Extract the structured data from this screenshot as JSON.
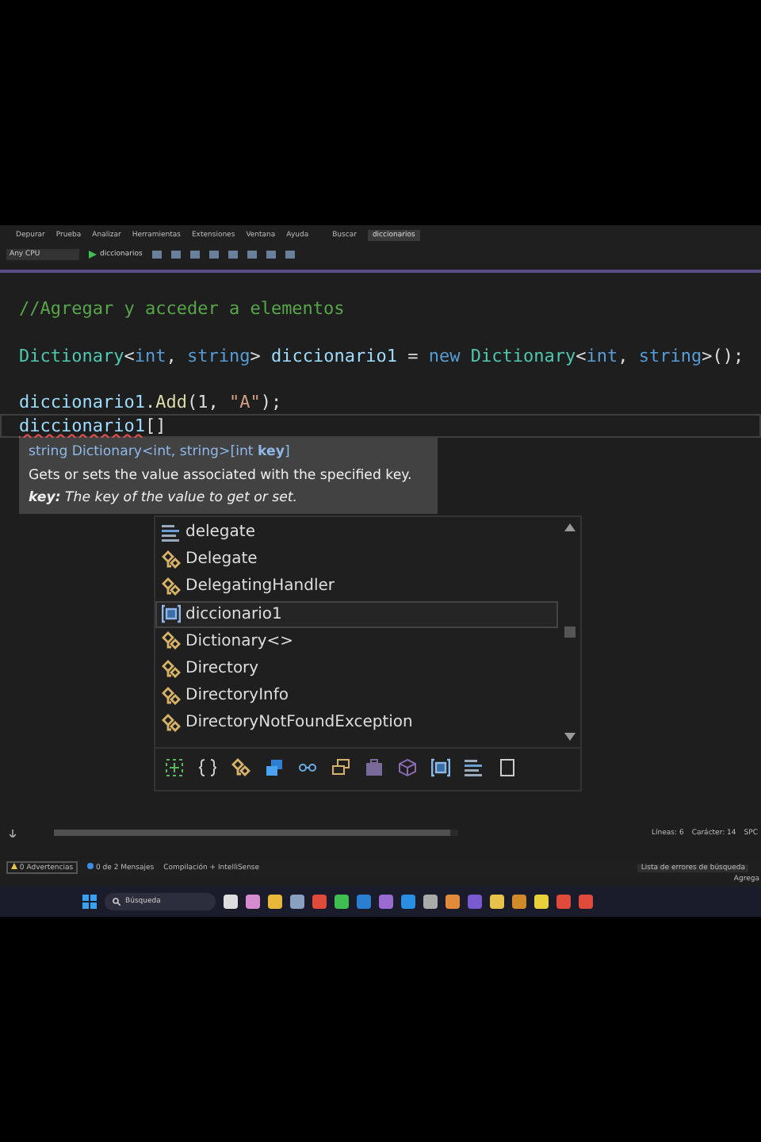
{
  "menu_bar": {
    "items": [
      "Depurar",
      "Prueba",
      "Analizar",
      "Herramientas",
      "Extensiones",
      "Ventana",
      "Ayuda"
    ],
    "search": "Buscar",
    "solution": "diccionarios"
  },
  "toolbar": {
    "platform": "Any CPU",
    "start": "diccionarios"
  },
  "editor": {
    "lines": [
      {
        "current": false,
        "tokens": [
          {
            "text": "//Agregar y acceder a elementos",
            "kind": "comment"
          }
        ]
      },
      {
        "current": false
      },
      {
        "current": false,
        "tokens": [
          {
            "text": "Dictionary",
            "kind": "type"
          },
          {
            "text": "<",
            "kind": "plain"
          },
          {
            "text": "int",
            "kind": "keyword"
          },
          {
            "text": ", ",
            "kind": "plain"
          },
          {
            "text": "string",
            "kind": "keyword"
          },
          {
            "text": "> ",
            "kind": "plain"
          },
          {
            "text": "diccionario1",
            "kind": "variable"
          },
          {
            "text": " = ",
            "kind": "plain"
          },
          {
            "text": "new ",
            "kind": "keyword"
          },
          {
            "text": "Dictionary",
            "kind": "type"
          },
          {
            "text": "<",
            "kind": "plain"
          },
          {
            "text": "int",
            "kind": "keyword"
          },
          {
            "text": ", ",
            "kind": "plain"
          },
          {
            "text": "string",
            "kind": "keyword"
          },
          {
            "text": ">();",
            "kind": "plain"
          }
        ]
      },
      {
        "current": false
      },
      {
        "current": false,
        "tokens": [
          {
            "text": "diccionario1",
            "kind": "variable"
          },
          {
            "text": ".",
            "kind": "plain"
          },
          {
            "text": "Add",
            "kind": "method"
          },
          {
            "text": "(1, ",
            "kind": "plain"
          },
          {
            "text": "\"A\"",
            "kind": "string"
          },
          {
            "text": ");",
            "kind": "plain"
          }
        ]
      },
      {
        "current": true,
        "tokens": [
          {
            "text": "diccionario1",
            "kind": "variable",
            "error": true
          },
          {
            "text": "[]",
            "kind": "plain"
          }
        ]
      }
    ]
  },
  "tooltip": {
    "signature": "string Dictionary<int, string>[int **key**]",
    "description": "Gets or sets the value associated with the specified key.",
    "parameter": "**key:** The key of the value to get or set."
  },
  "completion": {
    "items": [
      {
        "label": "delegate",
        "kind": "keyword",
        "selected": false
      },
      {
        "label": "Delegate",
        "kind": "class",
        "selected": false
      },
      {
        "label": "DelegatingHandler",
        "kind": "class",
        "selected": false
      },
      {
        "label": "diccionario1",
        "kind": "local",
        "selected": true
      },
      {
        "label": "Dictionary<>",
        "kind": "class",
        "selected": false
      },
      {
        "label": "Directory",
        "kind": "class",
        "selected": false
      },
      {
        "label": "DirectoryInfo",
        "kind": "class",
        "selected": false
      },
      {
        "label": "DirectoryNotFoundException",
        "kind": "class",
        "selected": false
      }
    ]
  },
  "status": {
    "lines": "Líneas: 6",
    "column": "Carácter: 14",
    "spacing": "SPC",
    "warnings": "0 Advertencias",
    "messages": "0 de 2 Mensajes",
    "build_filter": "Compilación + IntelliSense",
    "search_errors": "Lista de errores de búsqueda",
    "notice": "Agrega"
  },
  "taskbar": {
    "search": "Búsqueda"
  }
}
